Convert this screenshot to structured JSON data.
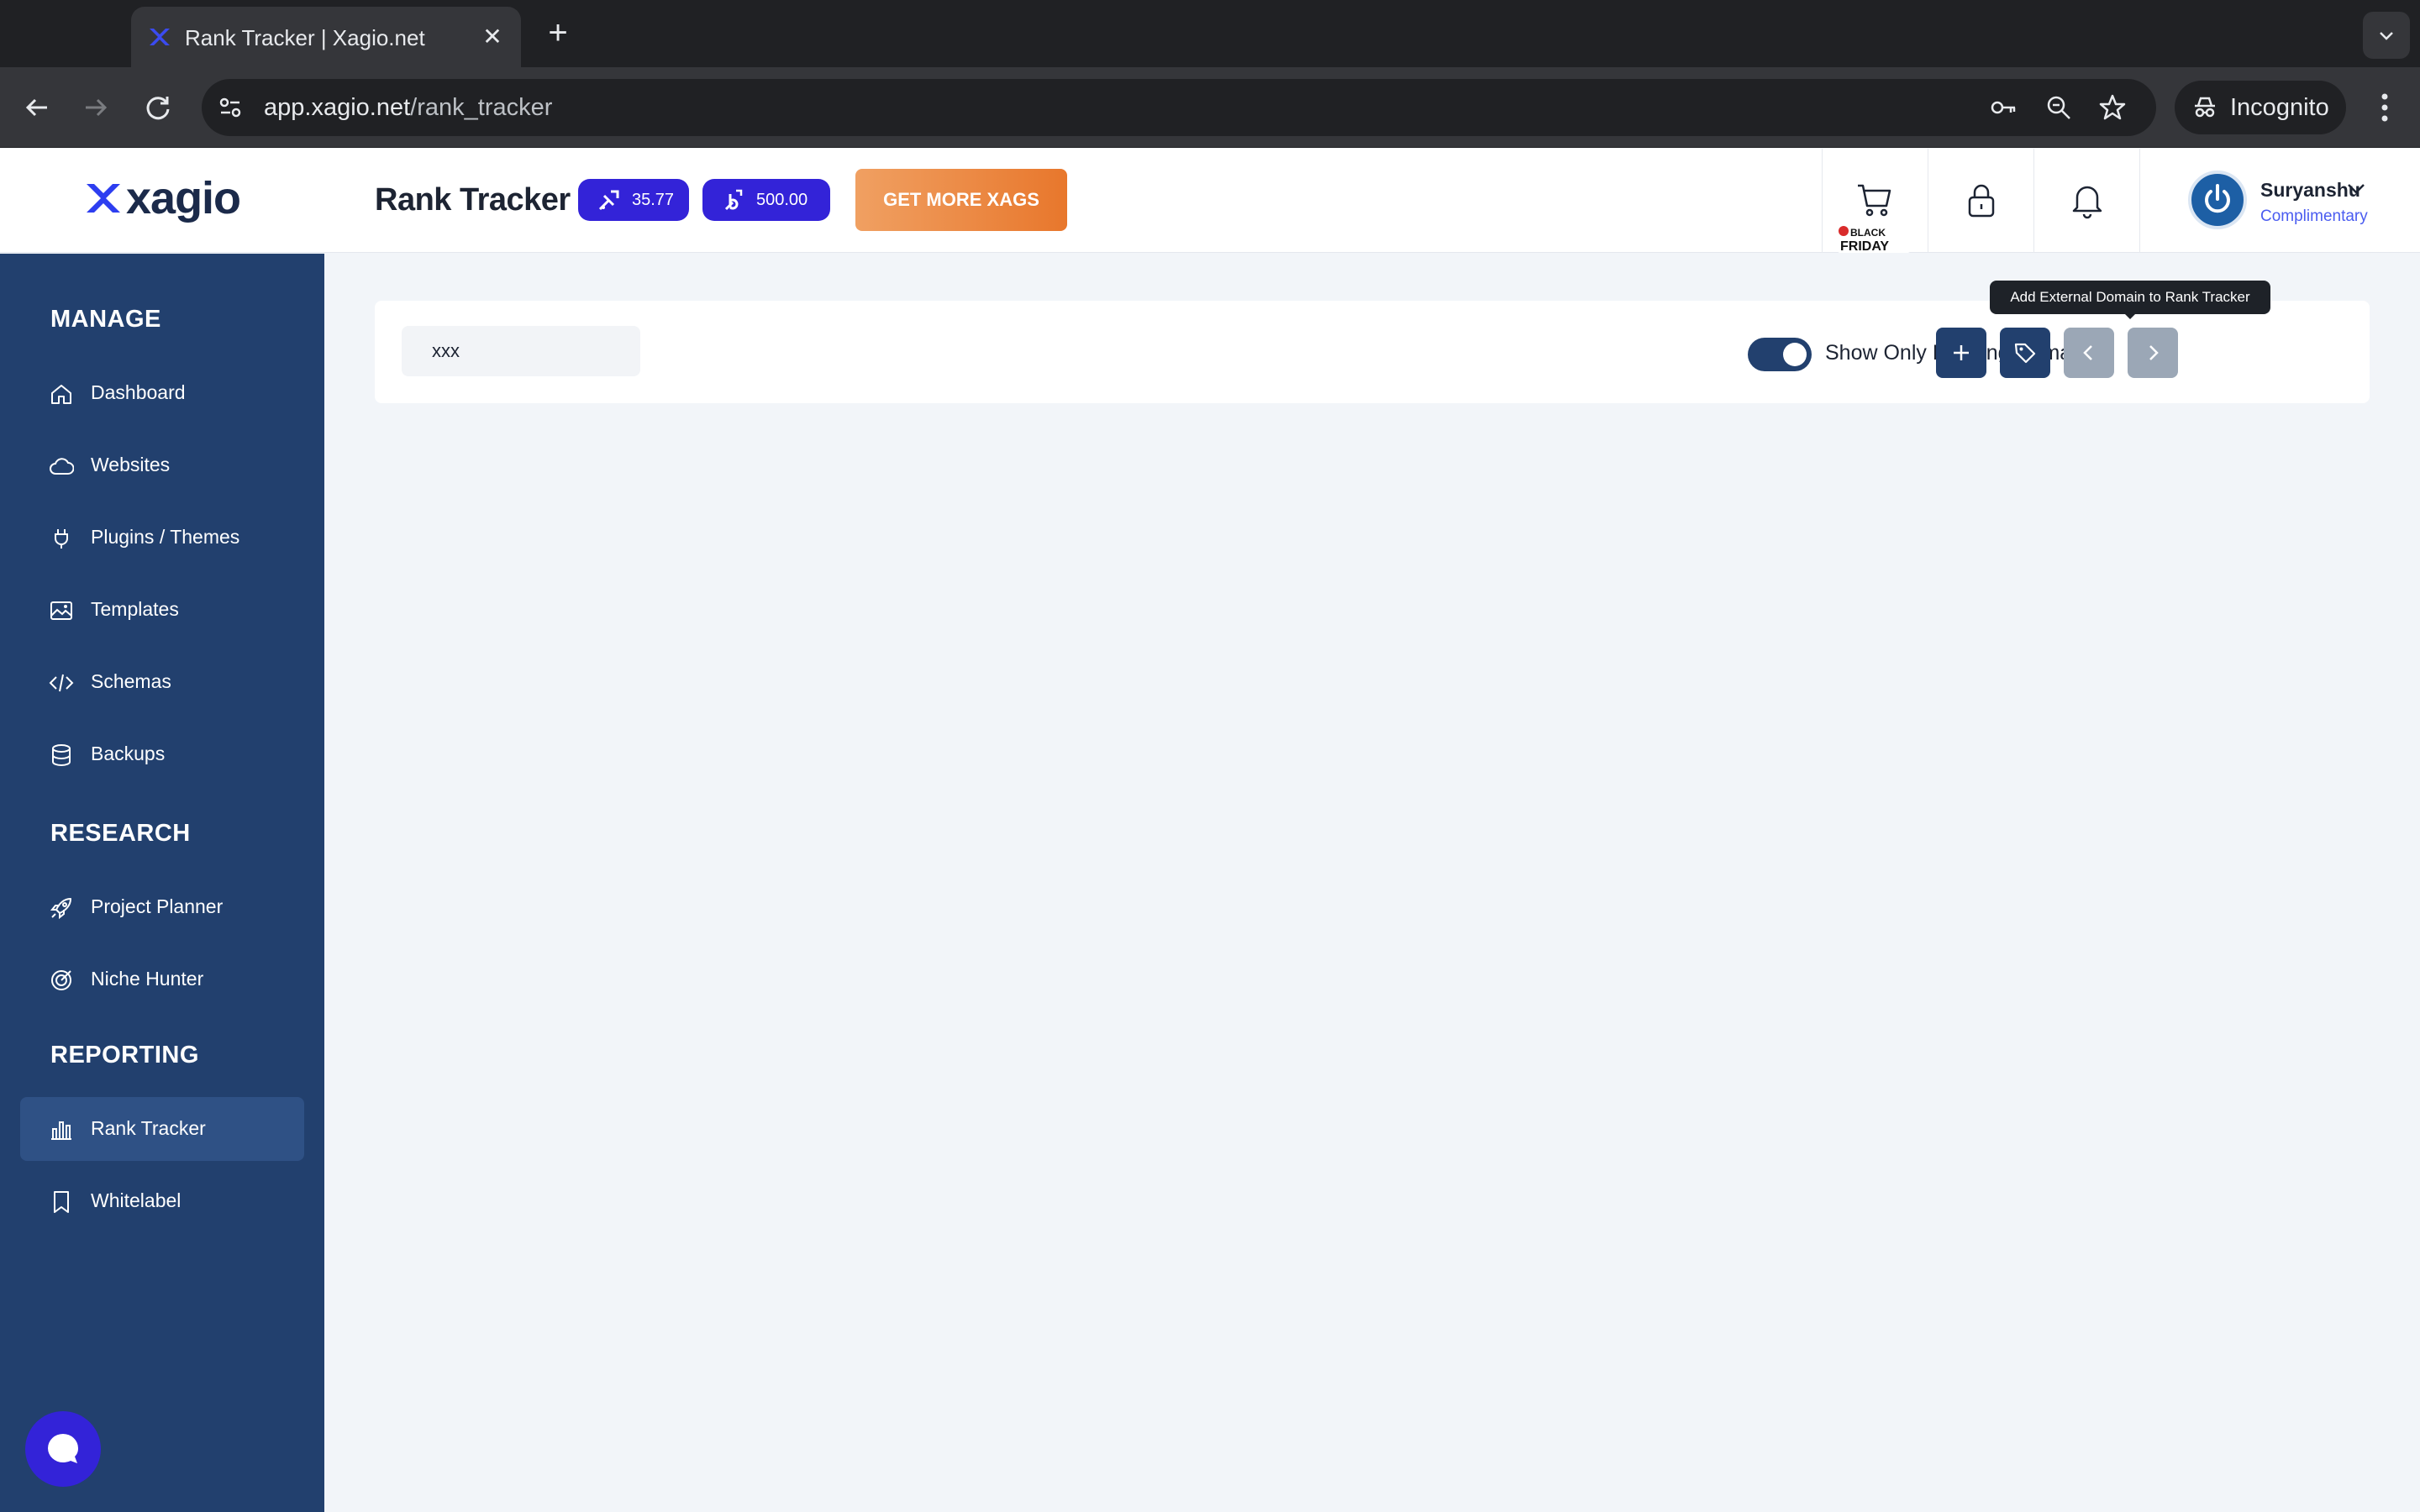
{
  "browser": {
    "tab_title": "Rank Tracker | Xagio.net",
    "tab_close": "✕",
    "new_tab": "+",
    "url_host": "app.xagio.net",
    "url_path": "/rank_tracker",
    "incognito_label": "Incognito"
  },
  "header": {
    "logo_text": "xagio",
    "page_title": "Rank Tracker",
    "xags_value": "35.77",
    "bonus_value": "500.00",
    "get_more_label": "GET MORE XAGS",
    "black_friday": "BLACK FRIDAY",
    "user_name": "Suryanshu",
    "user_plan": "Complimentary"
  },
  "sidebar": {
    "sections": [
      {
        "title": "MANAGE"
      },
      {
        "title": "RESEARCH"
      },
      {
        "title": "REPORTING"
      }
    ],
    "items": [
      {
        "label": "Dashboard",
        "icon": "home-icon"
      },
      {
        "label": "Websites",
        "icon": "cloud-icon"
      },
      {
        "label": "Plugins / Themes",
        "icon": "plug-icon"
      },
      {
        "label": "Templates",
        "icon": "image-icon"
      },
      {
        "label": "Schemas",
        "icon": "code-icon"
      },
      {
        "label": "Backups",
        "icon": "database-icon"
      },
      {
        "label": "Project Planner",
        "icon": "rocket-icon"
      },
      {
        "label": "Niche Hunter",
        "icon": "target-icon"
      },
      {
        "label": "Rank Tracker",
        "icon": "bar-chart-icon",
        "active": true
      },
      {
        "label": "Whitelabel",
        "icon": "bookmark-icon"
      }
    ]
  },
  "main": {
    "search_value": "xxx",
    "toggle_label": "Show Only Ranking Domains",
    "toggle_on": true,
    "tooltip": "Add External Domain to Rank Tracker"
  },
  "colors": {
    "sidebar": "#22406e",
    "accent": "#3323d8",
    "cta": "#e8772c"
  }
}
